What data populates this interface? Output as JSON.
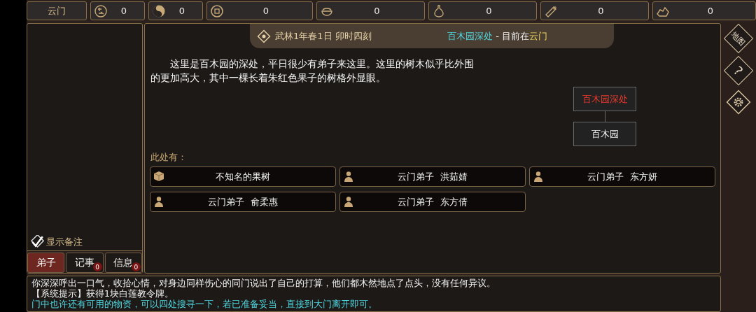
{
  "resources": {
    "sect": "云门",
    "items": [
      {
        "kind": "fame",
        "value": "0"
      },
      {
        "kind": "yinyang",
        "value": "0"
      },
      {
        "kind": "coin",
        "value": "0"
      },
      {
        "kind": "food",
        "value": "0"
      },
      {
        "kind": "herb",
        "value": "0"
      },
      {
        "kind": "wood",
        "value": "0"
      },
      {
        "kind": "ore",
        "value": "0"
      }
    ]
  },
  "header": {
    "date": "武林1年春1日 卯时四刻",
    "location": "百木园深处",
    "separator": " - 目前在",
    "sect": "云门"
  },
  "description": "这里是百木园的深处，平日很少有弟子来这里。这里的树木似乎比外围的更加高大，其中一棵长着朱红色果子的树格外显眼。",
  "map": {
    "nodes": [
      {
        "label": "百木园深处",
        "current": true
      },
      {
        "label": "百木园",
        "current": false
      }
    ]
  },
  "here": {
    "title": "此处有：",
    "entities": [
      {
        "kind": "object",
        "label": "不知名的果树"
      },
      {
        "kind": "person",
        "label": "云门弟子  洪茹婧"
      },
      {
        "kind": "person",
        "label": "云门弟子  东方妍"
      },
      {
        "kind": "person",
        "label": "云门弟子  俞柔惠"
      },
      {
        "kind": "person",
        "label": "云门弟子  东方倩"
      }
    ]
  },
  "notes_toggle": {
    "label": "显示备注",
    "checked": true
  },
  "tabs": [
    {
      "label": "弟子",
      "selected": true
    },
    {
      "label": "记事",
      "selected": false,
      "badge": "0"
    },
    {
      "label": "信息",
      "selected": false,
      "badge": "0"
    }
  ],
  "sidebar": {
    "map_label": "地图",
    "help_label": "?"
  },
  "log": [
    [
      {
        "kind": "plain",
        "text": "你深深呼出一口气，收拾心情，对身边同样伤心的同门说出了自己的打算，他们都木然地点了点头，没有任何异议。"
      }
    ],
    [
      {
        "kind": "plain",
        "text": "【系统提示】获得1块白莲教令牌。"
      }
    ],
    [
      {
        "kind": "hint",
        "text": "门中也许还有可用的物资，可以四处搜寻一下，若已准备妥当，直接到大门离开即可。"
      }
    ]
  ]
}
